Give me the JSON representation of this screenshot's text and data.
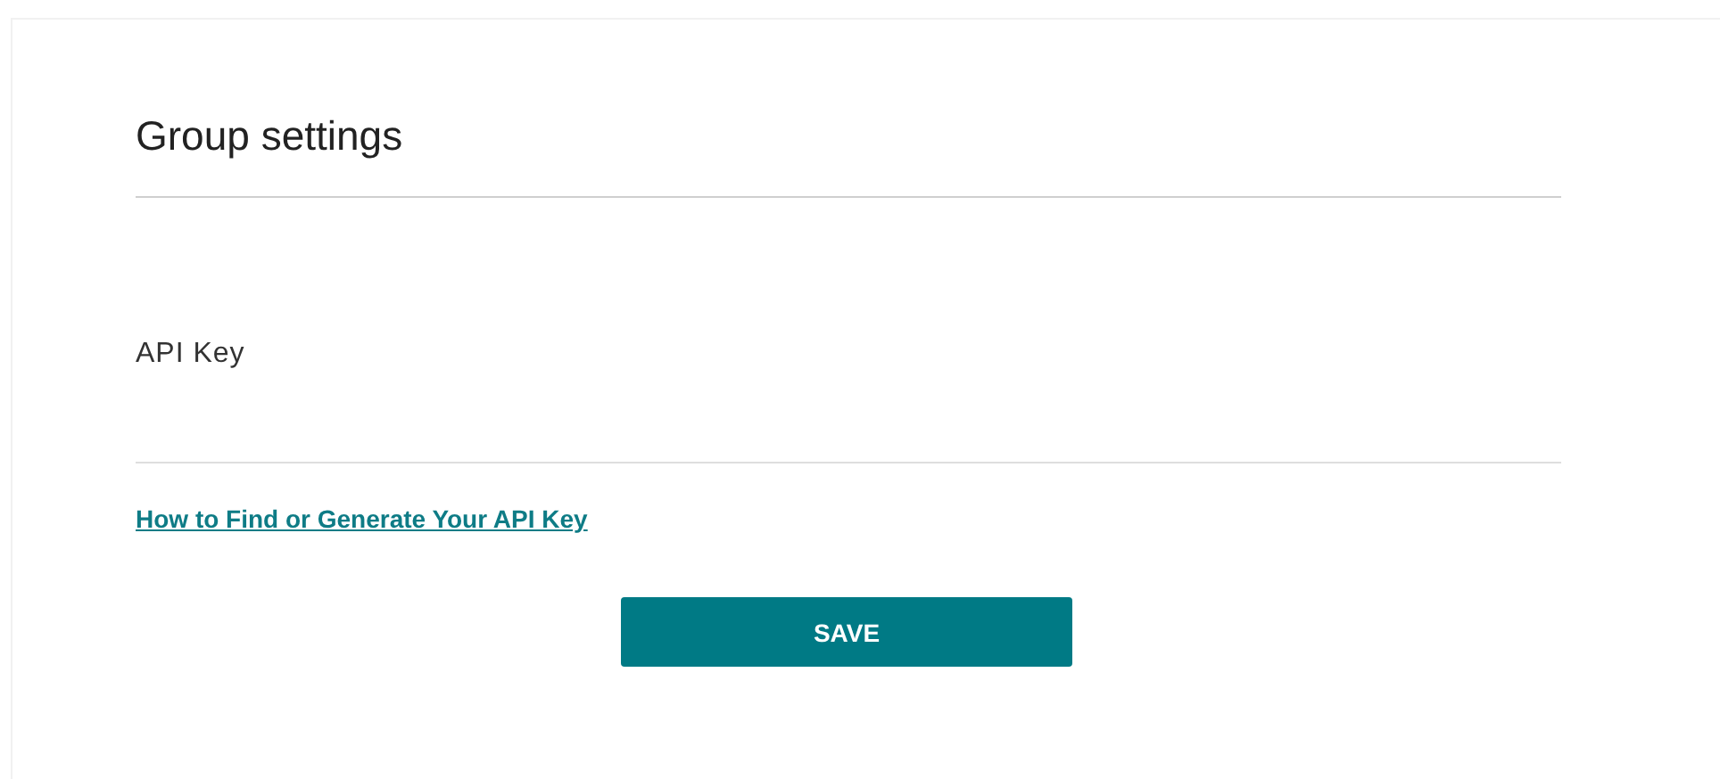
{
  "title": "Group settings",
  "field": {
    "label": "API Key"
  },
  "help_link": "How to Find or Generate Your API Key",
  "button": "SAVE"
}
